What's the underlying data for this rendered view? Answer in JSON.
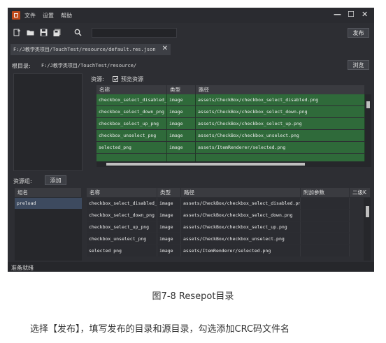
{
  "menu": {
    "file": "文件",
    "settings": "设置",
    "help": "帮助"
  },
  "window_controls": {
    "minimize": "—",
    "maximize": "☐",
    "close": "✕"
  },
  "toolbar": {
    "publish_label": "发布",
    "search_placeholder": ""
  },
  "tab": {
    "label": "F:/J教学类项目/TouchTest/resource/default.res.json",
    "close": "✕"
  },
  "root": {
    "label": "根目录:",
    "path": "F:/J教学类项目/TouchTest/resource/",
    "browse_label": "浏览"
  },
  "resources": {
    "header": "资源:",
    "preview_label": "预览资源",
    "preview_checked": true,
    "columns": [
      "名称",
      "类型",
      "路径"
    ],
    "rows": [
      {
        "name": "checkbox_select_disabled_png",
        "type": "image",
        "path": "assets/CheckBox/checkbox_select_disabled.png"
      },
      {
        "name": "checkbox_select_down_png",
        "type": "image",
        "path": "assets/CheckBox/checkbox_select_down.png"
      },
      {
        "name": "checkbox_select_up_png",
        "type": "image",
        "path": "assets/CheckBox/checkbox_select_up.png"
      },
      {
        "name": "checkbox_unselect_png",
        "type": "image",
        "path": "assets/CheckBox/checkbox_unselect.png"
      },
      {
        "name": "selected_png",
        "type": "image",
        "path": "assets/ItemRenderer/selected.png"
      },
      {
        "name": "",
        "type": "",
        "path": ""
      }
    ]
  },
  "groups": {
    "label": "资源组:",
    "add_label": "添加",
    "columns": [
      "组名"
    ],
    "items": [
      "preload"
    ]
  },
  "group_resources": {
    "columns": [
      "名称",
      "类型",
      "路径",
      "附加参数",
      "二级K"
    ],
    "rows": [
      {
        "name": "checkbox_select_disabled_png",
        "type": "image",
        "path": "assets/CheckBox/checkbox_select_disabled.png",
        "extra": ""
      },
      {
        "name": "checkbox_select_down_png",
        "type": "image",
        "path": "assets/CheckBox/checkbox_select_down.png",
        "extra": ""
      },
      {
        "name": "checkbox_select_up_png",
        "type": "image",
        "path": "assets/CheckBox/checkbox_select_up.png",
        "extra": ""
      },
      {
        "name": "checkbox_unselect_png",
        "type": "image",
        "path": "assets/CheckBox/checkbox_unselect.png",
        "extra": ""
      },
      {
        "name": "selected png",
        "type": "image",
        "path": "assets/ItemRenderer/selected.png",
        "extra": ""
      }
    ]
  },
  "status": {
    "text": "准备就绪"
  },
  "caption": "图7-8 Resepot目录",
  "body_text": "选择【发布】，填写发布的目录和源目录，勾选添加CRC码文件名",
  "colors": {
    "app_bg": "#2d2e33",
    "row_green": "#2f6a3a",
    "logo": "#c04a1a"
  },
  "icons": [
    "new-file-icon",
    "open-folder-icon",
    "save-icon",
    "save-all-icon",
    "search-icon"
  ]
}
